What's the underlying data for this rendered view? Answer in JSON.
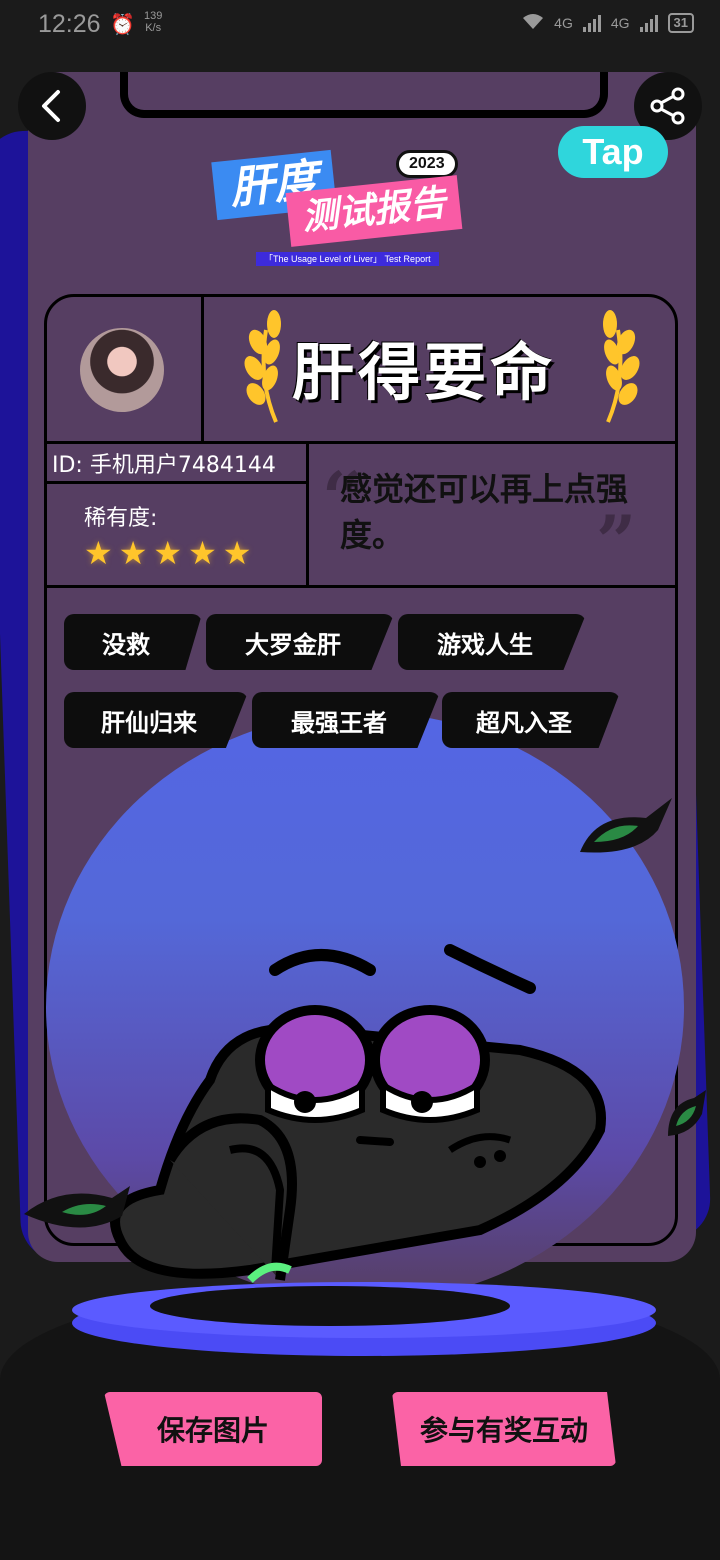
{
  "status_bar": {
    "time": "12:26",
    "speed_value": "139",
    "speed_unit": "K/s",
    "network_1": "4G",
    "network_2": "4G",
    "battery": "31"
  },
  "header": {
    "back_icon": "chevron-left-icon",
    "share_icon": "share-icon",
    "tap_logo": "Tap"
  },
  "report_logo": {
    "line1": "肝度",
    "year": "2023",
    "line2": "测试报告",
    "subtitle": "「The Usage Level of Liver」 Test Report"
  },
  "profile": {
    "rank_title": "肝得要命",
    "user_id": "ID: 手机用户7484144",
    "rarity_label": "稀有度:",
    "rarity_stars": 5,
    "comment": "感觉还可以再上点强度。"
  },
  "tags": [
    "没救",
    "大罗金肝",
    "游戏人生",
    "肝仙归来",
    "最强王者",
    "超凡入圣"
  ],
  "actions": {
    "save_image": "保存图片",
    "join_interaction": "参与有奖互动"
  },
  "colors": {
    "card": "#563e62",
    "accent_pink": "#fb63a6",
    "accent_blue": "#3b8bf2",
    "star": "#ffc52b",
    "tap_brand": "#2fd6dc"
  }
}
